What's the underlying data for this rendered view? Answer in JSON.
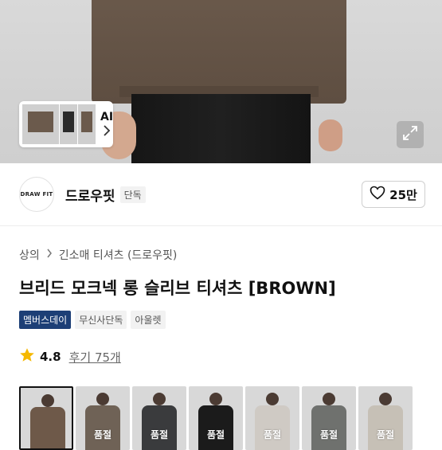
{
  "hero": {
    "thumb_label": "AI",
    "thumb_chevron": "chevron-right-icon",
    "expand_icon": "expand-icon"
  },
  "brand": {
    "logo_text": "DRAW FIT",
    "name": "드로우핏",
    "tag": "단독",
    "like_count": "25만"
  },
  "breadcrumb": {
    "level1": "상의",
    "separator_icon": "chevron-right-icon",
    "level2": "긴소매 티셔츠 (드로우핏)"
  },
  "product": {
    "title": "브리드 모크넥 롱 슬리브 티셔츠 [BROWN]",
    "badges": [
      "멤버스데이",
      "무신사단독",
      "아울렛"
    ]
  },
  "rating": {
    "icon": "star-icon",
    "value": "4.8",
    "review_link": "후기 75개"
  },
  "swatches": [
    {
      "color": "#6e5949",
      "soldout": ""
    },
    {
      "color": "#6f6256",
      "soldout": "품절"
    },
    {
      "color": "#3a3b3d",
      "soldout": "품절"
    },
    {
      "color": "#1b1b1b",
      "soldout": "품절"
    },
    {
      "color": "#cfcac4",
      "soldout": "품절"
    },
    {
      "color": "#6f716e",
      "soldout": "품절"
    },
    {
      "color": "#c6c0b6",
      "soldout": "품절"
    }
  ],
  "colors": {
    "badge_primary": "#1d3f76",
    "star": "#f5b800"
  }
}
